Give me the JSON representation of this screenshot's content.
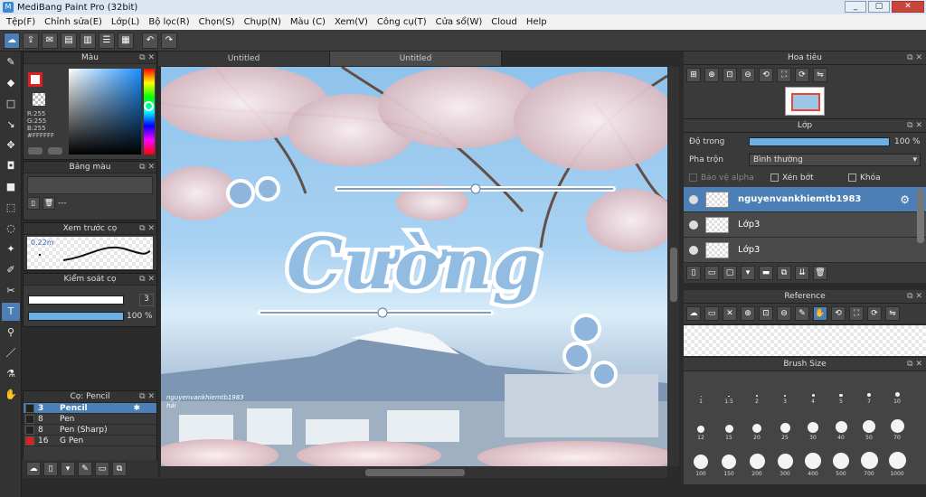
{
  "window": {
    "title": "MediBang Paint Pro (32bit)",
    "controls": [
      "_",
      "▢",
      "✕"
    ]
  },
  "menu": [
    "Tệp(F)",
    "Chỉnh sửa(E)",
    "Lớp(L)",
    "Bộ lọc(R)",
    "Chọn(S)",
    "Chụp(N)",
    "Màu (C)",
    "Xem(V)",
    "Công cụ(T)",
    "Cửa sổ(W)",
    "Cloud",
    "Help"
  ],
  "toolbar": {
    "undo": "↶",
    "redo": "↷"
  },
  "color_panel": {
    "title": "Màu",
    "rgb": [
      "R:255",
      "G:255",
      "B:255"
    ],
    "hex": "#FFFFFF",
    "primary": "#ffffff",
    "outline": "#e02020"
  },
  "palette_panel": {
    "title": "Bảng màu",
    "dash": "---"
  },
  "brush_preview": {
    "title": "Xem trước cọ",
    "size": "0.22m"
  },
  "brush_control": {
    "title": "Kiểm soát cọ",
    "size": "3",
    "opacity": "100 %",
    "opacity_value": 100
  },
  "brush_list": {
    "title": "Cọ: Pencil",
    "items": [
      {
        "size": "3",
        "name": "Pencil",
        "color": "#222222",
        "selected": true
      },
      {
        "size": "8",
        "name": "Pen",
        "color": "#222222",
        "selected": false
      },
      {
        "size": "8",
        "name": "Pen (Sharp)",
        "color": "#222222",
        "selected": false
      },
      {
        "size": "16",
        "name": "G Pen",
        "color": "#e02020",
        "selected": false
      }
    ]
  },
  "doc_tabs": [
    "Untitled",
    "Untitled"
  ],
  "canvas": {
    "title_text": "Cường",
    "watermark": [
      "nguyenvankhiemtb1983",
      "hải"
    ]
  },
  "navigator": {
    "title": "Hoa tiêu"
  },
  "layers_panel": {
    "title": "Lớp",
    "opacity_label": "Độ trong",
    "opacity_value": "100 %",
    "opacity": 100,
    "blend_label": "Pha trộn",
    "blend_value": "Bình thường",
    "protect_alpha": "Bảo vệ alpha",
    "clipping": "Xén bớt",
    "lock": "Khóa",
    "layers": [
      {
        "name": "nguyenvankhiemtb1983",
        "selected": true
      },
      {
        "name": "Lớp3",
        "selected": false
      },
      {
        "name": "Lớp3",
        "selected": false
      }
    ]
  },
  "reference": {
    "title": "Reference"
  },
  "brush_size": {
    "title": "Brush Size",
    "sizes": [
      "1",
      "1.5",
      "2",
      "3",
      "4",
      "5",
      "7",
      "10",
      "12",
      "15",
      "20",
      "25",
      "30",
      "40",
      "50",
      "70",
      "100",
      "150",
      "200",
      "300",
      "400",
      "500",
      "700",
      "1000"
    ]
  }
}
